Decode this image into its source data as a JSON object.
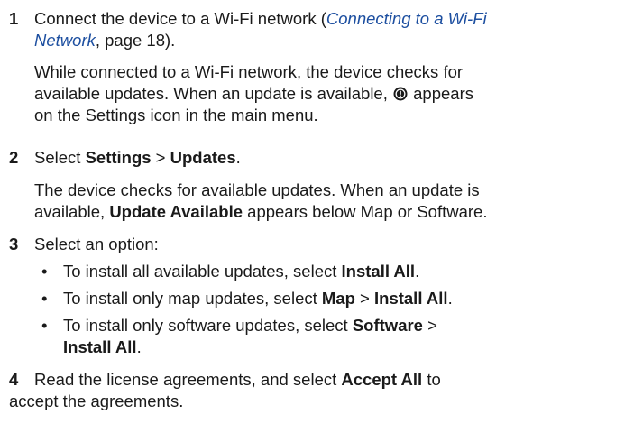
{
  "steps": [
    {
      "number": "1",
      "text1_a": "Connect the device to a Wi-Fi network (",
      "text1_link1": "Connecting to a Wi-Fi",
      "text1_link2": "Network",
      "text1_b": ", page 18).",
      "para_line1": "While connected to a Wi-Fi network, the device checks for",
      "para_line2_a": "available updates. When an update is available,",
      "para_line2_b": "appears",
      "para_line3": "on the Settings icon in the main menu."
    },
    {
      "number": "2",
      "text_a": "Select ",
      "settings": "Settings",
      "sep": " > ",
      "updates": "Updates",
      "text_end": ".",
      "para_line1": "The device checks for available updates. When an update is",
      "para_line2_a": "available, ",
      "update_available": "Update Available",
      "para_line2_b": " appears below Map or Software."
    },
    {
      "number": "3",
      "text": "Select an option:",
      "bullets": [
        {
          "a": "To install all available updates, select ",
          "b1": "Install All",
          "c": "."
        },
        {
          "a": "To install only map updates, select ",
          "b1": "Map",
          "sep": " > ",
          "b2": "Install All",
          "c": "."
        },
        {
          "a": "To install only software updates, select ",
          "b1": "Software",
          "sep": " >",
          "b2": "Install All",
          "c": "."
        }
      ],
      "bullet_char": "•"
    },
    {
      "number": "4",
      "line1_a": "Read the license agreements, and select ",
      "accept_all": "Accept All",
      "line1_b": " to",
      "line2": "accept the agreements."
    }
  ],
  "colors": {
    "text": "#1a1a1a",
    "link": "#1d4fa0"
  },
  "icons": {
    "update_alert": "alert-badge-icon"
  }
}
